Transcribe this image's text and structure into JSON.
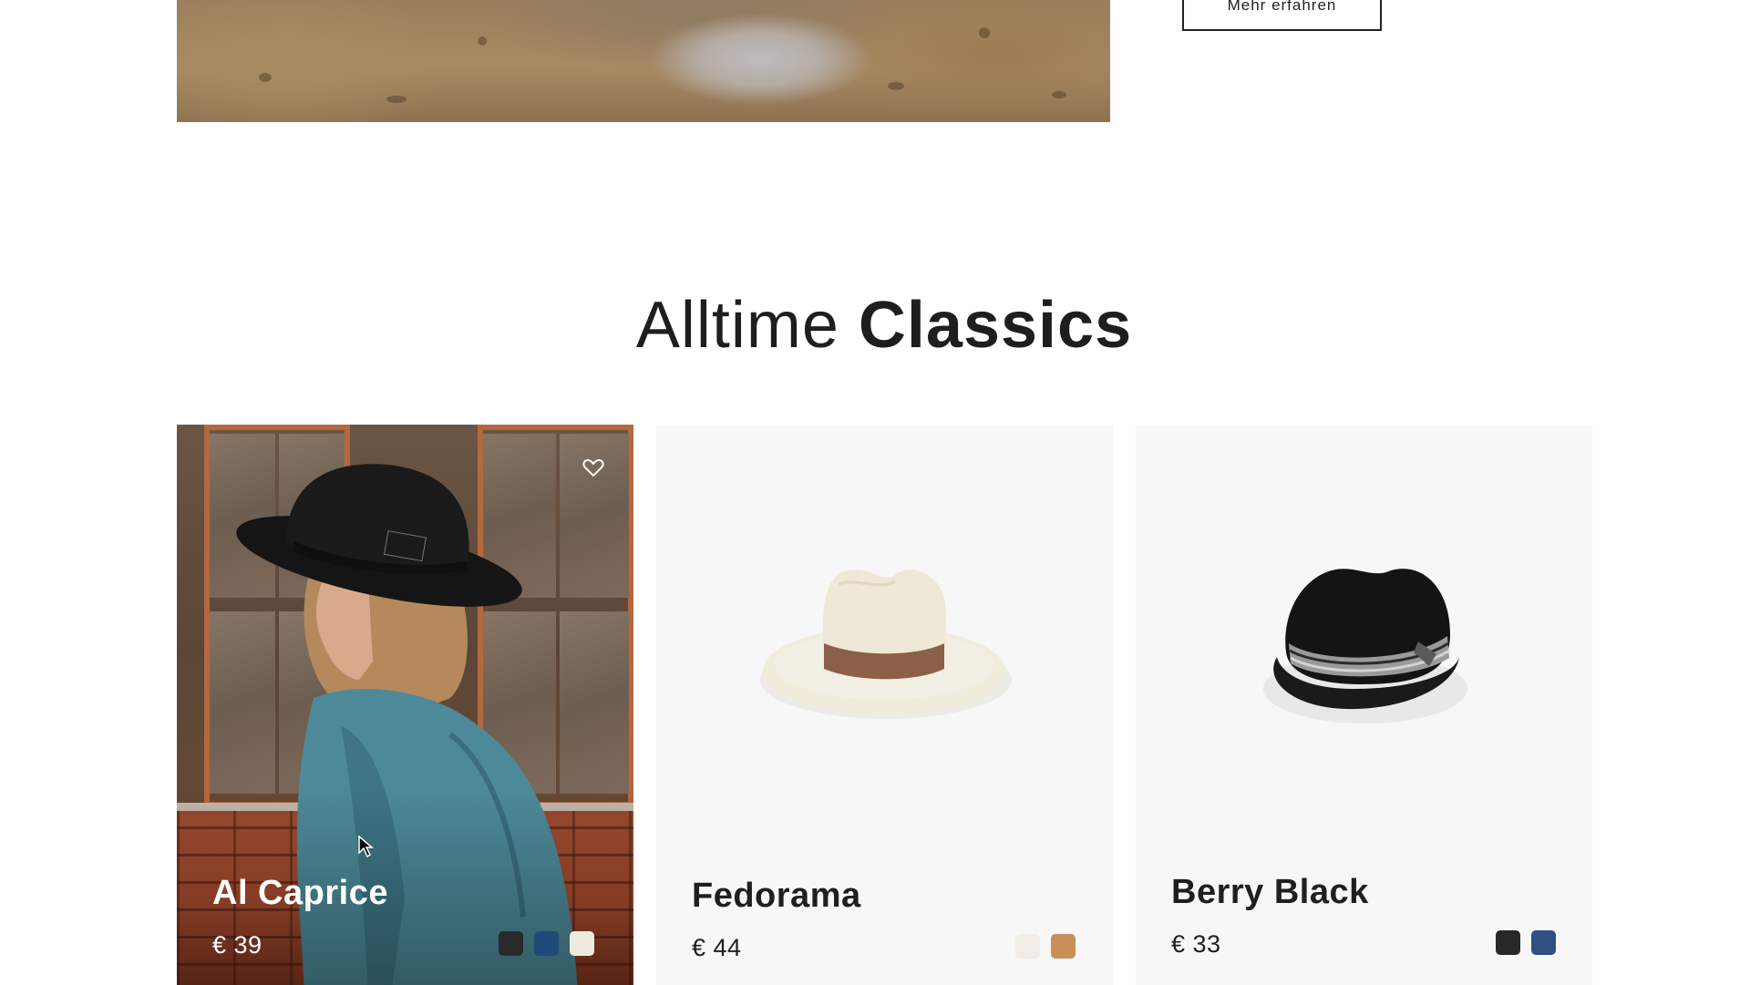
{
  "banner": {
    "more_button_label": "Mehr erfahren"
  },
  "section": {
    "title_light": "Alltime",
    "title_bold": "Classics"
  },
  "products": [
    {
      "name": "Al Caprice",
      "price": "€ 39",
      "image": "woman-in-black-hat-and-denim-jacket-photo",
      "favorite_icon": "heart-icon",
      "colors": [
        "#2a2a2a",
        "#1f4a7a",
        "#efeae0"
      ]
    },
    {
      "name": "Fedorama",
      "price": "€ 44",
      "image": "cream-fedora-with-brown-band",
      "colors": [
        "#efede6",
        "#c98f5a"
      ]
    },
    {
      "name": "Berry Black",
      "price": "€ 33",
      "image": "black-trilby-with-grey-striped-band",
      "colors": [
        "#272727",
        "#2f4f83"
      ]
    }
  ],
  "colors": {
    "text": "#1f1f1f",
    "card_background": "#f7f7f8",
    "page_background": "#ffffff"
  }
}
